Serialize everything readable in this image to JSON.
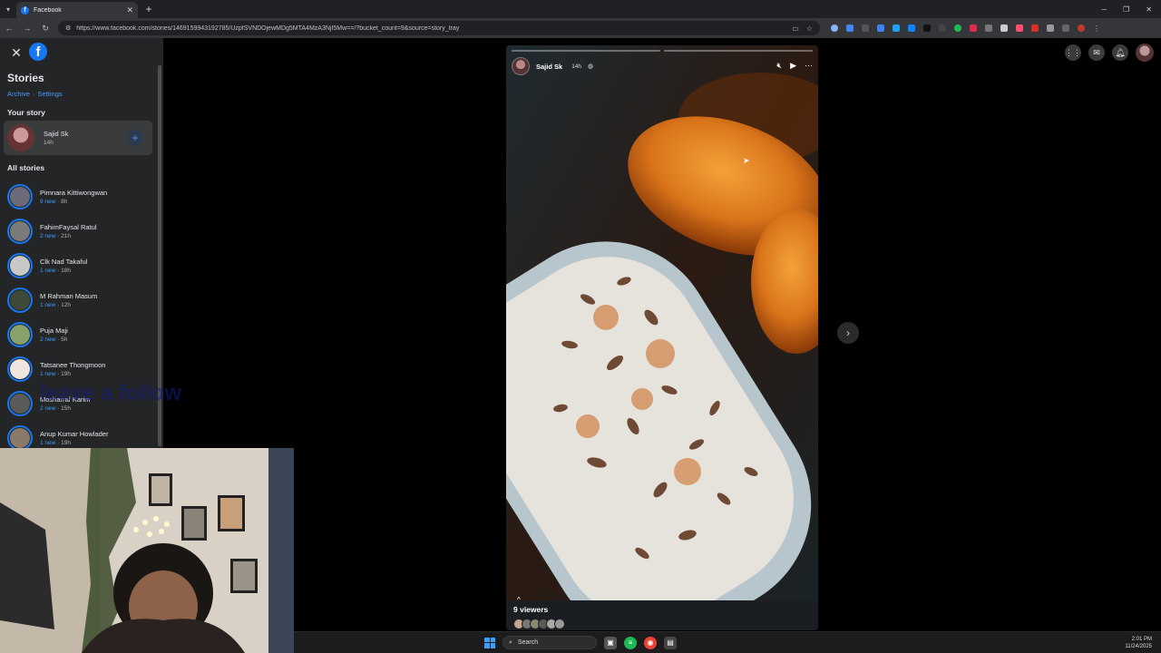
{
  "browser": {
    "tab_title": "Facebook",
    "url": "https://www.facebook.com/stories/1469159943192785/UzpfSVNDOjewMDg5MTA4MzA3NjI5Mw==/?bucket_count=9&source=story_tray"
  },
  "sidebar": {
    "title": "Stories",
    "archive_link": "Archive",
    "separator": "·",
    "settings_link": "Settings",
    "your_story_heading": "Your story",
    "own_story": {
      "name": "Sajid Sk",
      "time": "14h"
    },
    "all_stories_heading": "All stories",
    "stories": [
      {
        "name": "Pimnara Kittiwongwan",
        "new": "9 new",
        "ago": "8h",
        "color": "#6f6a7a"
      },
      {
        "name": "FahimFaysal Ratul",
        "new": "2 new",
        "ago": "21h",
        "color": "#7a7a7a"
      },
      {
        "name": "Clk Nad Takaful",
        "new": "1 new",
        "ago": "18h",
        "color": "#c8c8c8"
      },
      {
        "name": "M Rahman Masum",
        "new": "1 new",
        "ago": "12h",
        "color": "#3d4a3a"
      },
      {
        "name": "Puja Maji",
        "new": "2 new",
        "ago": "5h",
        "color": "#88a06a"
      },
      {
        "name": "Tatsanee Thongmoon",
        "new": "1 new",
        "ago": "19h",
        "color": "#f0e6df"
      },
      {
        "name": "Mosharraf Karim",
        "new": "2 new",
        "ago": "15h",
        "color": "#5a5a5a"
      },
      {
        "name": "Anup Kumar Howlader",
        "new": "1 new",
        "ago": "19h",
        "color": "#8a7a6a"
      }
    ]
  },
  "story": {
    "author": "Sajid Sk",
    "time": "14h",
    "viewers_label": "9 viewers"
  },
  "overlay": {
    "text": "leave a follow"
  },
  "taskbar": {
    "search_placeholder": "Search",
    "time": "2:01 PM",
    "date": "11/24/2025"
  }
}
